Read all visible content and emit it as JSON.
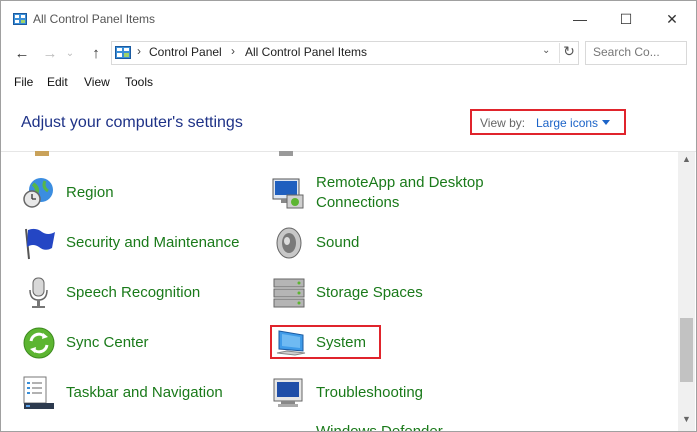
{
  "window": {
    "title": "All Control Panel Items",
    "minimize": "—",
    "maximize": "☐",
    "close": "✕"
  },
  "nav": {
    "back": "←",
    "forward": "→",
    "dropdown": "⌄",
    "up": "↑"
  },
  "address": {
    "crumbs": [
      "Control Panel",
      "All Control Panel Items"
    ],
    "separator": "›",
    "refresh": "↻",
    "dropdown": "⌄"
  },
  "search": {
    "placeholder": "Search Co..."
  },
  "menu": [
    "File",
    "Edit",
    "View",
    "Tools"
  ],
  "header": {
    "title": "Adjust your computer's settings",
    "view_by_label": "View by:",
    "view_by_value": "Large icons"
  },
  "items": {
    "left": [
      "Region",
      "Security and Maintenance",
      "Speech Recognition",
      "Sync Center",
      "Taskbar and Navigation"
    ],
    "right": [
      "RemoteApp and Desktop",
      "Connections",
      "Sound",
      "Storage Spaces",
      "System",
      "Troubleshooting"
    ],
    "partial_bottom": "Windows Defender"
  },
  "colors": {
    "accent_red": "#e0242c",
    "link_green": "#1a7a1a",
    "heading_blue": "#1e3287",
    "dropdown_blue": "#1c64c8"
  }
}
